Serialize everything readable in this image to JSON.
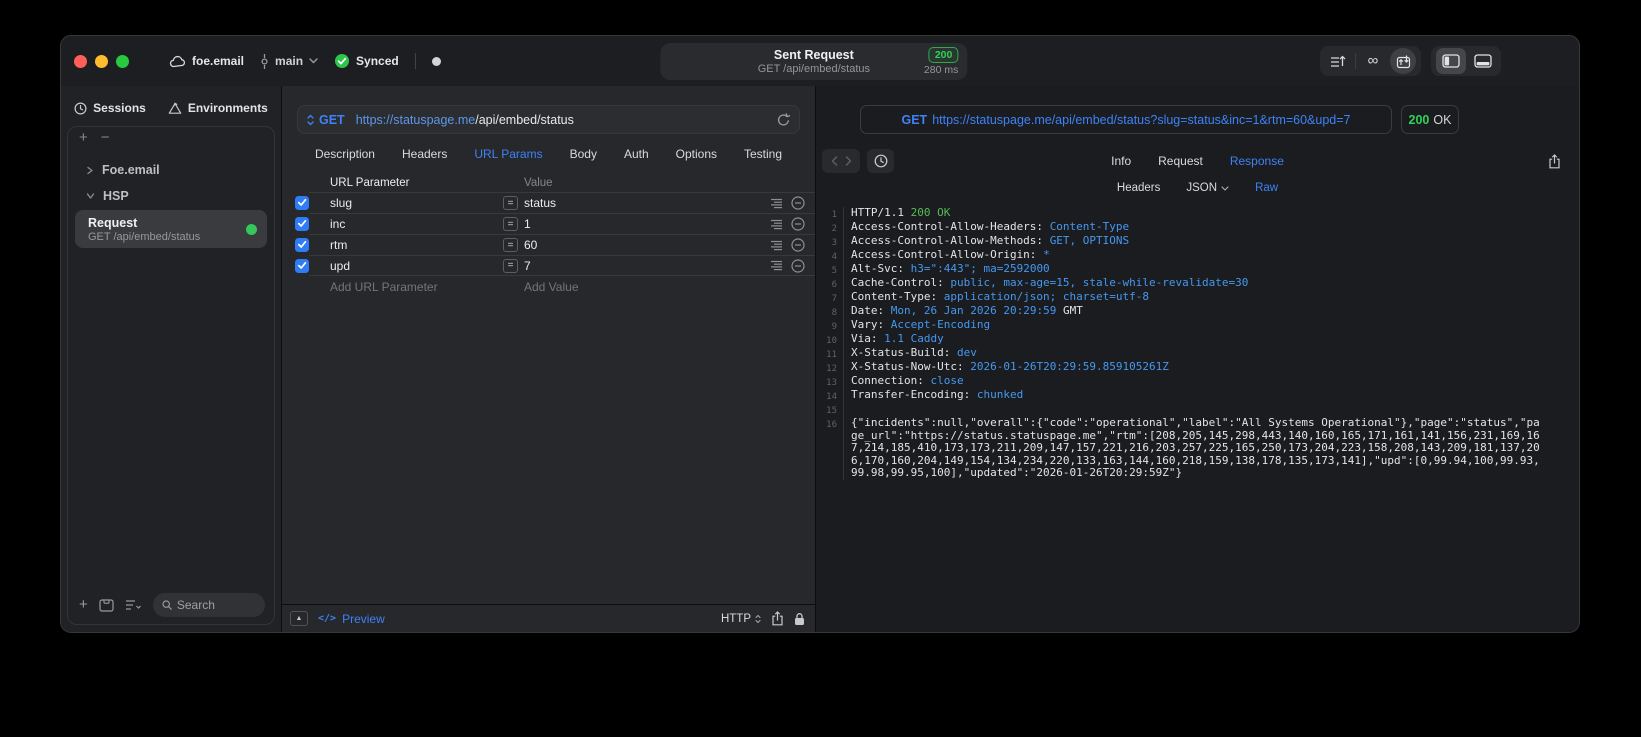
{
  "window": {
    "account": "foe.email",
    "branch": "main",
    "sync_status": "Synced",
    "title": "Sent Request",
    "subtitle": "GET /api/embed/status",
    "status_code": "200",
    "duration": "280 ms"
  },
  "sidebar": {
    "tabs": [
      {
        "label": "Sessions"
      },
      {
        "label": "Environments"
      }
    ],
    "tree": [
      {
        "label": "Foe.email",
        "state": "collapsed"
      },
      {
        "label": "HSP",
        "state": "expanded"
      }
    ],
    "request_item": {
      "title": "Request",
      "subtitle": "GET /api/embed/status"
    },
    "search_placeholder": "Search"
  },
  "request": {
    "method": "GET",
    "url_host": "https://statuspage.me",
    "url_path": "/api/embed/status",
    "tabs": [
      "Description",
      "Headers",
      "URL Params",
      "Body",
      "Auth",
      "Options",
      "Testing"
    ],
    "active_tab": "URL Params",
    "table": {
      "columns": [
        "URL Parameter",
        "Value"
      ],
      "rows": [
        {
          "name": "slug",
          "value": "status",
          "checked": true
        },
        {
          "name": "inc",
          "value": "1",
          "checked": true
        },
        {
          "name": "rtm",
          "value": "60",
          "checked": true
        },
        {
          "name": "upd",
          "value": "7",
          "checked": true
        }
      ],
      "add_parameter_placeholder": "Add URL Parameter",
      "add_value_placeholder": "Add Value"
    },
    "footer": {
      "preview_label": "Preview",
      "protocol": "HTTP"
    }
  },
  "response": {
    "method": "GET",
    "url": "https://statuspage.me/api/embed/status?slug=status&inc=1&rtm=60&upd=7",
    "status_code": "200",
    "status_text": "OK",
    "tabs": [
      "Info",
      "Request",
      "Response"
    ],
    "active_tab": "Response",
    "subtabs": [
      "Headers",
      "JSON",
      "Raw"
    ],
    "active_subtab": "Raw",
    "raw": {
      "status_line": {
        "protocol": "HTTP/1.1",
        "status": "200 OK"
      },
      "headers": [
        {
          "name": "Access-Control-Allow-Headers",
          "value": "Content-Type"
        },
        {
          "name": "Access-Control-Allow-Methods",
          "value": "GET, OPTIONS"
        },
        {
          "name": "Access-Control-Allow-Origin",
          "value": "*"
        },
        {
          "name": "Alt-Svc",
          "value": "h3=\":443\"; ma=2592000"
        },
        {
          "name": "Cache-Control",
          "value": "public, max-age=15, stale-while-revalidate=30"
        },
        {
          "name": "Content-Type",
          "value": "application/json; charset=utf-8"
        },
        {
          "name": "Date",
          "value": "Mon, 26 Jan 2026 20:29:59",
          "suffix": " GMT"
        },
        {
          "name": "Vary",
          "value": "Accept-Encoding"
        },
        {
          "name": "Via",
          "value": "1.1 Caddy"
        },
        {
          "name": "X-Status-Build",
          "value": "dev"
        },
        {
          "name": "X-Status-Now-Utc",
          "value": "2026-01-26T20:29:59.859105261Z"
        },
        {
          "name": "Connection",
          "value": "close"
        },
        {
          "name": "Transfer-Encoding",
          "value": "chunked"
        }
      ],
      "body": "{\"incidents\":null,\"overall\":{\"code\":\"operational\",\"label\":\"All Systems Operational\"},\"page\":\"status\",\"page_url\":\"https://status.statuspage.me\",\"rtm\":[208,205,145,298,443,140,160,165,171,161,141,156,231,169,167,214,185,410,173,173,211,209,147,157,221,216,203,257,225,165,250,173,204,223,158,208,143,209,181,137,206,170,160,204,149,154,134,234,220,133,163,144,160,218,159,138,178,135,173,141],\"upd\":[0,99.94,100,99.93,99.98,99.95,100],\"updated\":\"2026-01-26T20:29:59Z\"}"
    }
  },
  "colors": {
    "accent_blue": "#3e82f7",
    "status_green": "#30d158",
    "value_blue": "#4598f0"
  }
}
